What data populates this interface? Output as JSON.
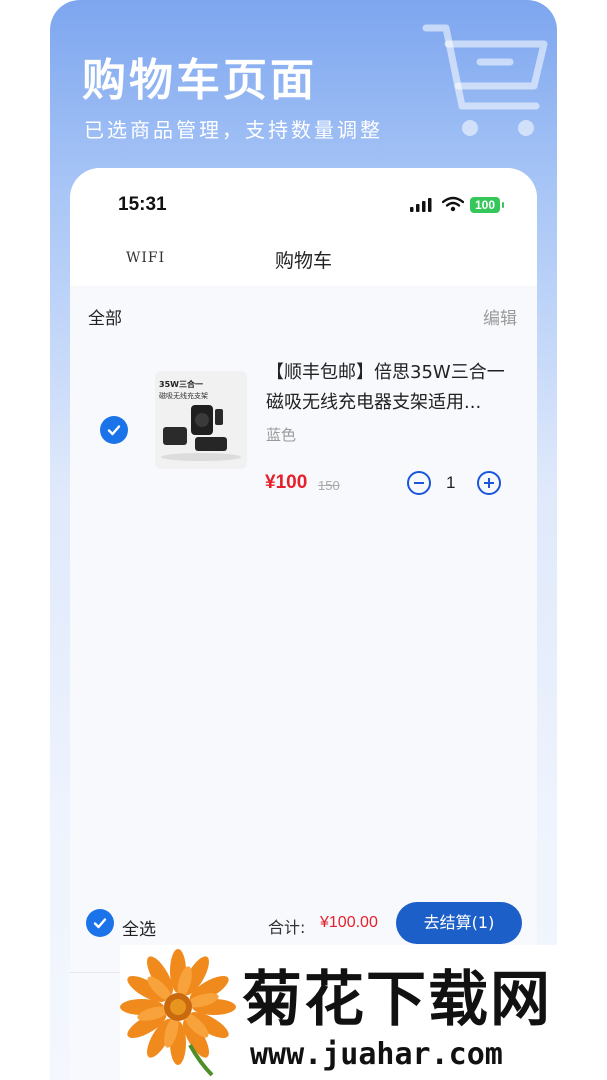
{
  "promo": {
    "title": "购物车页面",
    "subtitle": "已选商品管理，支持数量调整"
  },
  "status_bar": {
    "time": "15:31",
    "battery": "100"
  },
  "nav": {
    "left_label": "WIFI",
    "title": "购物车"
  },
  "list": {
    "filter_label": "全部",
    "edit_label": "编辑"
  },
  "product": {
    "image_caption_1": "35W三合一",
    "image_caption_2": "磁吸无线充支架",
    "title": "【顺丰包邮】倍思35W三合一磁吸无线充电器支架适用...",
    "variant": "蓝色",
    "price": "¥100",
    "original_price": "150",
    "quantity": "1",
    "selected": true
  },
  "footer": {
    "select_all_label": "全选",
    "total_label": "合计:",
    "total_value": "¥100.00",
    "checkout_label": "去结算(1)"
  },
  "watermark": {
    "name": "菊花下载网",
    "url": "www.juahar.com"
  },
  "colors": {
    "accent": "#1d5fc8",
    "price": "#e5202a",
    "battery": "#35c759"
  }
}
